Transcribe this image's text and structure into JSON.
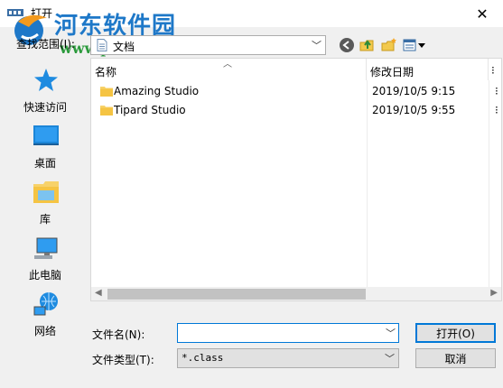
{
  "window": {
    "title": "打开",
    "close_glyph": "✕"
  },
  "watermark": {
    "title": "河东软件园",
    "url": "www.pc0359.cn"
  },
  "look_in": {
    "label": "查找范围(I):",
    "value": "文档",
    "icon": "document-icon",
    "toolbar_icons": [
      "back-icon",
      "up-folder-icon",
      "new-folder-icon",
      "view-menu-icon"
    ]
  },
  "places": [
    {
      "label": "快速访问",
      "icon": "star-icon"
    },
    {
      "label": "桌面",
      "icon": "desktop-icon"
    },
    {
      "label": "库",
      "icon": "library-icon"
    },
    {
      "label": "此电脑",
      "icon": "computer-icon"
    },
    {
      "label": "网络",
      "icon": "network-icon"
    }
  ],
  "file_list": {
    "columns": [
      "名称",
      "修改日期",
      "⁝"
    ],
    "rows": [
      {
        "name": "Amazing Studio",
        "date": "2019/10/5 9:15",
        "extra": "⁝"
      },
      {
        "name": "Tipard Studio",
        "date": "2019/10/5 9:55",
        "extra": "⁝"
      }
    ]
  },
  "file_name": {
    "label": "文件名(N):",
    "value": ""
  },
  "file_type": {
    "label": "文件类型(T):",
    "value": "*.class"
  },
  "buttons": {
    "open": "打开(O)",
    "cancel": "取消"
  },
  "colors": {
    "accent": "#0078d7",
    "watermark_blue": "#1e78c8",
    "watermark_green": "#2b9a3c",
    "folder": "#f7d26a"
  }
}
